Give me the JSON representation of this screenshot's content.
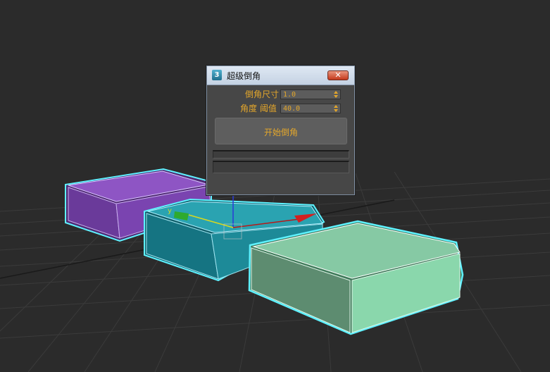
{
  "dialog": {
    "title": "超级倒角",
    "app_icon_text": "3",
    "close_symbol": "✕",
    "fields": [
      {
        "label": "倒角尺寸",
        "value": "1.0"
      },
      {
        "label": "角度 阈值",
        "value": "40.0"
      }
    ],
    "start_button_label": "开始倒角",
    "progress": [
      0,
      0
    ]
  },
  "viewport": {
    "background_color": "#2b2b2b",
    "axis_y_label": "y",
    "objects": [
      {
        "name": "purple-box",
        "color": "#8a4bbf"
      },
      {
        "name": "teal-box",
        "color": "#1f8a98"
      },
      {
        "name": "green-box",
        "color": "#82c9a3"
      }
    ],
    "selection_color": "#5ff2ff",
    "accent_color": "#e4a72b"
  }
}
